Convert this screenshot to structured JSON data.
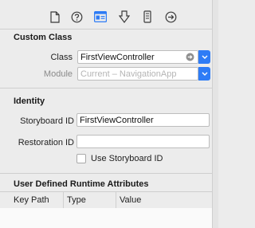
{
  "toolbar": {
    "tabs": [
      {
        "icon": "file-inspector-icon"
      },
      {
        "icon": "quick-help-icon"
      },
      {
        "icon": "identity-inspector-icon",
        "active": true
      },
      {
        "icon": "attributes-inspector-icon"
      },
      {
        "icon": "size-inspector-icon"
      },
      {
        "icon": "connections-inspector-icon"
      }
    ]
  },
  "custom_class": {
    "title": "Custom Class",
    "class_label": "Class",
    "class_value": "FirstViewController",
    "module_label": "Module",
    "module_placeholder": "Current – NavigationApp"
  },
  "identity": {
    "title": "Identity",
    "storyboard_id_label": "Storyboard ID",
    "storyboard_id_value": "FirstViewController",
    "restoration_id_label": "Restoration ID",
    "restoration_id_value": "",
    "use_storyboard_id_label": "Use Storyboard ID",
    "use_storyboard_id_checked": false
  },
  "runtime_attributes": {
    "title": "User Defined Runtime Attributes",
    "columns": [
      "Key Path",
      "Type",
      "Value"
    ]
  },
  "colors": {
    "accent": "#2e7cf6",
    "panel_bg": "#ececec"
  }
}
